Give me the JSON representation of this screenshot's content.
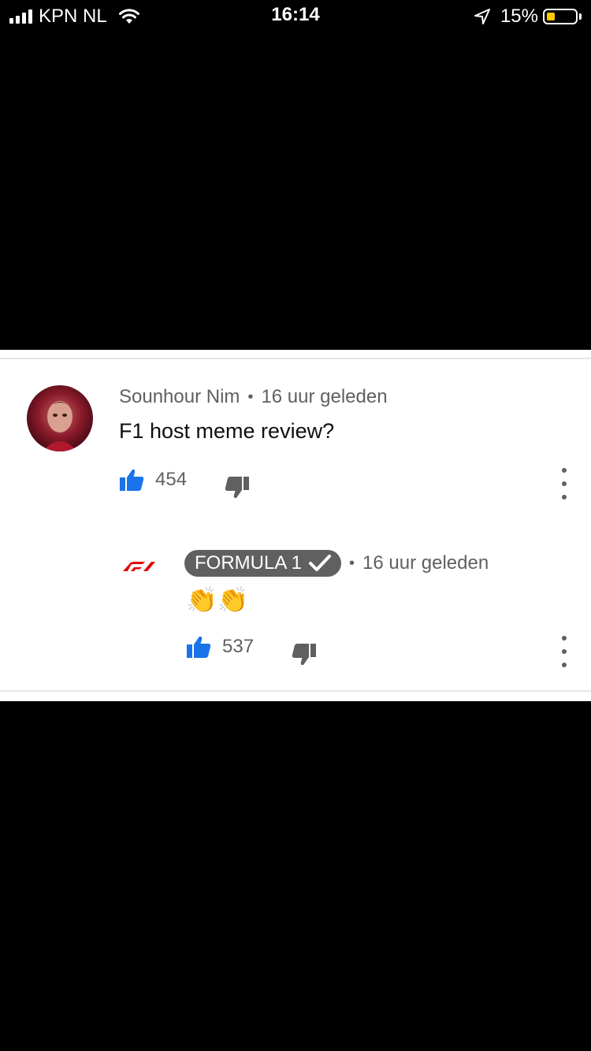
{
  "status_bar": {
    "carrier": "KPN NL",
    "time": "16:14",
    "battery": "15%",
    "battery_level": 0.15
  },
  "comments": [
    {
      "author": "Sounhour Nim",
      "separator": "•",
      "timestamp": "16 uur geleden",
      "text": "F1 host meme review?",
      "likes": "454"
    }
  ],
  "reply": {
    "author": "FORMULA 1",
    "verified": true,
    "separator": "•",
    "timestamp": "16 uur geleden",
    "text": "👏👏",
    "likes": "537"
  },
  "icons": {
    "like": "thumbs-up-icon",
    "dislike": "thumbs-down-icon",
    "more": "more-vertical-icon",
    "verified": "check-icon"
  },
  "colors": {
    "like_blue": "#1a73e8",
    "f1_red": "#e10600",
    "meta_gray": "#606060"
  }
}
